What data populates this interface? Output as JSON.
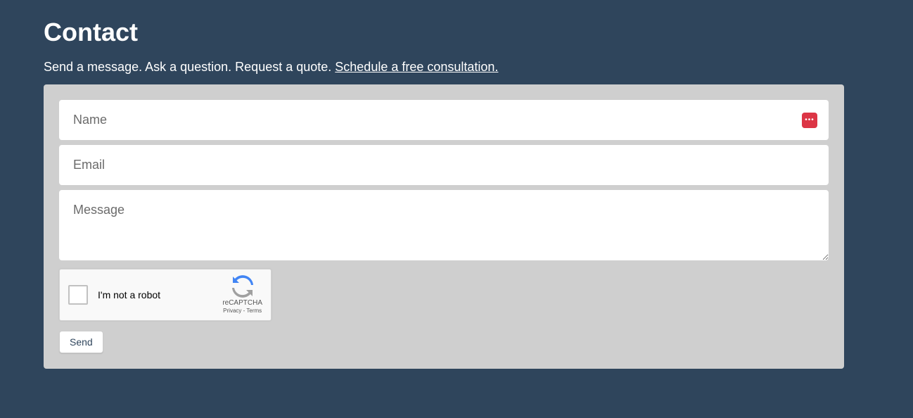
{
  "header": {
    "title": "Contact",
    "intro_prefix": "Send a message. Ask a question. Request a quote. ",
    "intro_link": "Schedule a free consultation."
  },
  "form": {
    "name_placeholder": "Name",
    "email_placeholder": "Email",
    "message_placeholder": "Message",
    "recaptcha": {
      "label": "I'm not a robot",
      "brand": "reCAPTCHA",
      "links": "Privacy - Terms"
    },
    "send_label": "Send"
  }
}
